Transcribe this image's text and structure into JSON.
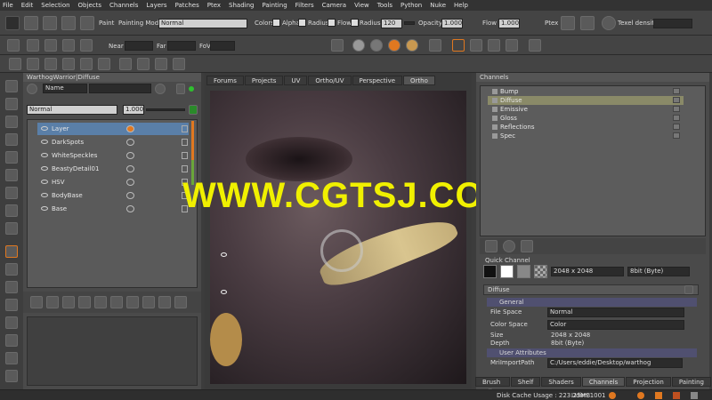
{
  "menu": [
    "File",
    "Edit",
    "Selection",
    "Objects",
    "Channels",
    "Layers",
    "Patches",
    "Ptex",
    "Shading",
    "Painting",
    "Filters",
    "Camera",
    "View",
    "Tools",
    "Python",
    "Nuke",
    "Help"
  ],
  "toolbar": {
    "paint_label": "Paint",
    "painting_mode_label": "Painting Mode",
    "painting_mode_value": "Normal",
    "colors_label": "Colors",
    "alpha_label": "Alpha",
    "radius_label": "Radius",
    "flow_label": "Flow",
    "radius2_label": "Radius",
    "radius_value": "120",
    "opacity_label": "Opacity",
    "opacity_value": "1.000",
    "flow2_label": "Flow",
    "flow_value": "1.000",
    "ptex_label": "Ptex",
    "texel_label": "Texel density :",
    "near_label": "Near",
    "far_label": "Far",
    "fov_label": "FoV"
  },
  "layers_panel": {
    "title": "WarthogWarrior|Diffuse",
    "search_mode": "Name",
    "blend_mode": "Normal",
    "opacity": "1.000",
    "layers": [
      "Layer",
      "DarkSpots",
      "WhiteSpeckles",
      "BeastyDetail01",
      "HSV",
      "BodyBase",
      "Base"
    ]
  },
  "viewport": {
    "tabs": [
      "Forums",
      "Projects",
      "UV",
      "Ortho/UV",
      "Perspective",
      "Ortho"
    ],
    "active_tab": "Ortho",
    "watermark": "WWW.CGTSJ.COM"
  },
  "channels": {
    "title": "Channels",
    "items": [
      "Bump",
      "Diffuse",
      "Emissive",
      "Gloss",
      "Reflections",
      "Spec"
    ],
    "selected": "Diffuse",
    "quick_channel_label": "Quick Channel",
    "size_value": "2048 x 2048",
    "depth_value": "8bit  (Byte)",
    "properties_title": "Diffuse",
    "general_label": "General",
    "file_space_label": "File Space",
    "file_space_value": "Normal",
    "color_space_label": "Color Space",
    "color_space_value": "Color",
    "size_label": "Size",
    "size_info": "2048 x 2048",
    "depth_label": "Depth",
    "depth_info": "8bit  (Byte)",
    "user_attr_label": "User Attributes",
    "import_path_label": "MriImportPath",
    "import_path_value": "C:/Users/eddie/Desktop/warthog"
  },
  "bottom_tabs": [
    "Brush Editor",
    "Shelf",
    "Shaders",
    "Channels",
    "Projection",
    "Painting"
  ],
  "bottom_active": "Channels",
  "status": {
    "disk_cache": "Disk Cache Usage : 223.23MB",
    "udim": "Udim:1001"
  }
}
